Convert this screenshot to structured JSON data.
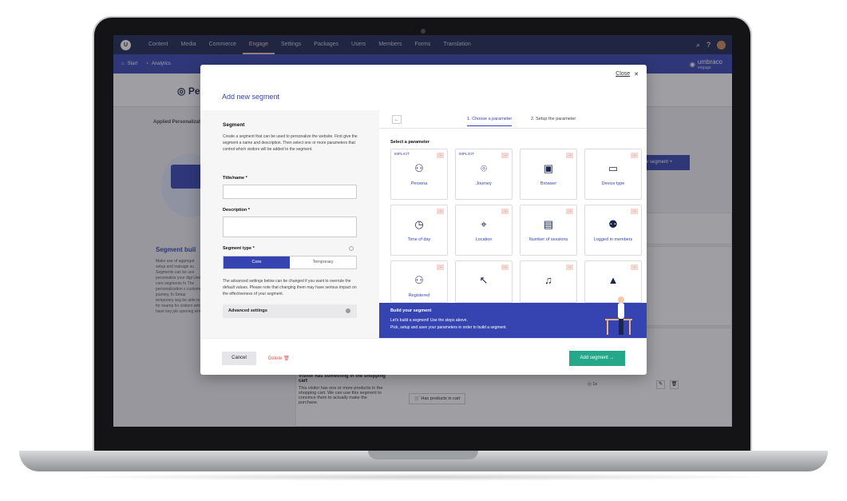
{
  "app": {
    "nav": [
      "Content",
      "Media",
      "Commerce",
      "Engage",
      "Settings",
      "Packages",
      "Users",
      "Members",
      "Forms",
      "Translation"
    ],
    "active_nav": "Engage",
    "subnav": {
      "start": "Start",
      "analytics": "Analytics"
    },
    "brand": {
      "name": "umbraco",
      "sub": "engage"
    }
  },
  "page": {
    "title": "Perso",
    "applied": "Applied Personalizati",
    "new_segment_btn": "w segment +",
    "segment_builder_heading": "Segment buil",
    "side_text": "Make use of aggregat setup and manage su Segments can be use personalize your digi Use core segments fo The personalization s customer journey, fo Setup temporary seg be able to, for examp for visitors who have key job opening whic",
    "row": {
      "title": "Visitor has something in the shopping cart",
      "text": "This visitor has one or more products in the shopping cart. We can use this segment to convince them to actually make the purchase.",
      "badge": "Has products in cart",
      "count": "1x"
    }
  },
  "modal": {
    "title": "Add new segment",
    "close_label": "Close",
    "segment_heading": "Segment",
    "segment_desc": "Create a segment that can be used to personalize the website. First give the segment a name and description. Then select one or more parameters that control which visitors will be added to the segment.",
    "title_label": "Title/name *",
    "description_label": "Description *",
    "segment_type_label": "Segment type *",
    "segment_type": {
      "core": "Core",
      "temporary": "Temporary",
      "selected": "Core"
    },
    "advanced_text": "The advanced settings below can be changed if you want to overrule the default values. Please note that changing them may have serious impact on the effectiveness of your segment.",
    "advanced_btn": "Advanced settings",
    "steps": {
      "back": "←",
      "step1": "1. Choose a parameter",
      "step2": "2. Setup the parameter"
    },
    "select_label": "Select a parameter",
    "params": [
      {
        "label": "Persona",
        "implicit": "IMPLICIT",
        "icon": "persona-icon",
        "glyph": "⚇"
      },
      {
        "label": "Journey",
        "implicit": "IMPLICIT",
        "icon": "journey-icon",
        "glyph": "⌾"
      },
      {
        "label": "Browser",
        "implicit": "",
        "icon": "browser-icon",
        "glyph": "▣"
      },
      {
        "label": "Device type",
        "implicit": "",
        "icon": "device-icon",
        "glyph": "▭"
      },
      {
        "label": "Time of day",
        "implicit": "",
        "icon": "clock-icon",
        "glyph": "◷"
      },
      {
        "label": "Location",
        "implicit": "",
        "icon": "location-icon",
        "glyph": "⌖"
      },
      {
        "label": "Number of sessions",
        "implicit": "",
        "icon": "sessions-icon",
        "glyph": "▤"
      },
      {
        "label": "Logged in members",
        "implicit": "",
        "icon": "members-icon",
        "glyph": "⚉"
      },
      {
        "label": "Registered",
        "implicit": "",
        "icon": "registered-icon",
        "glyph": "⚇"
      },
      {
        "label": "",
        "implicit": "",
        "icon": "cursor-icon",
        "glyph": "↖"
      },
      {
        "label": "",
        "implicit": "",
        "icon": "bell-icon",
        "glyph": "♫"
      },
      {
        "label": "",
        "implicit": "",
        "icon": "rocket-icon",
        "glyph": "▲"
      }
    ],
    "banner": {
      "title": "Build your segment",
      "line1": "Let's build a segment! Use the steps above.",
      "line2": "Pick, setup and save your parameters in order to build a segment."
    },
    "cancel": "Cancel",
    "delete": "Delete",
    "add": "Add segment →"
  }
}
